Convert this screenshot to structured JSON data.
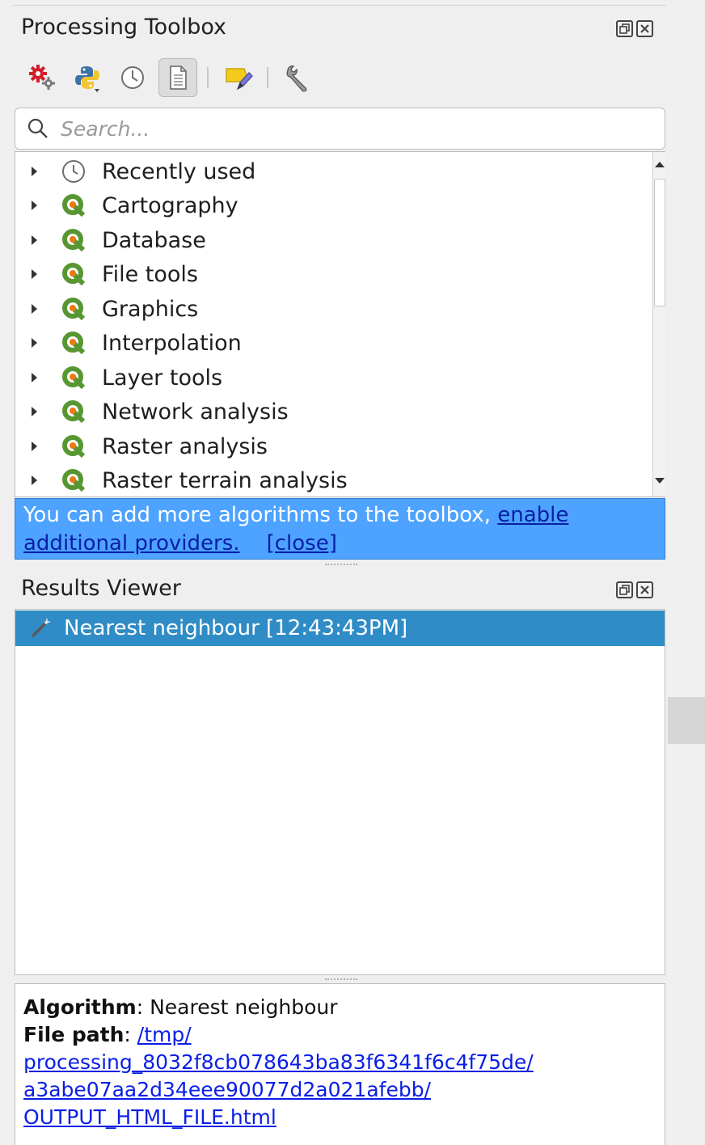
{
  "toolbox": {
    "title": "Processing Toolbox",
    "toolbar": [
      "models-icon",
      "python-icon",
      "history-icon",
      "results-icon",
      "edit-features-icon",
      "options-icon"
    ],
    "search_placeholder": "Search...",
    "groups": [
      {
        "label": "Recently used",
        "icon": "clock-icon"
      },
      {
        "label": "Cartography",
        "icon": "qgis-icon"
      },
      {
        "label": "Database",
        "icon": "qgis-icon"
      },
      {
        "label": "File tools",
        "icon": "qgis-icon"
      },
      {
        "label": "Graphics",
        "icon": "qgis-icon"
      },
      {
        "label": "Interpolation",
        "icon": "qgis-icon"
      },
      {
        "label": "Layer tools",
        "icon": "qgis-icon"
      },
      {
        "label": "Network analysis",
        "icon": "qgis-icon"
      },
      {
        "label": "Raster analysis",
        "icon": "qgis-icon"
      },
      {
        "label": "Raster terrain analysis",
        "icon": "qgis-icon"
      }
    ],
    "notice": {
      "text": "You can add more algorithms to the toolbox, ",
      "link1": "enable",
      "link1_cont": "additional providers.",
      "link2": "[close]"
    }
  },
  "results": {
    "title": "Results Viewer",
    "items": [
      {
        "label": "Nearest neighbour [12:43:43PM]"
      }
    ],
    "details": {
      "algorithm_label": "Algorithm",
      "algorithm_value": "Nearest neighbour",
      "filepath_label": "File path",
      "filepath_line1": "/tmp/",
      "filepath_line2": "processing_8032f8cb078643ba83f6341f6c4f75de/",
      "filepath_line3": "a3abe07aa2d34eee90077d2a021afebb/",
      "filepath_line4": "OUTPUT_HTML_FILE.html"
    }
  },
  "colors": {
    "accent": "#308cc6",
    "notice_bg": "#4da3ff",
    "qgis_green": "#589632",
    "qgis_yellow": "#ee7913"
  }
}
